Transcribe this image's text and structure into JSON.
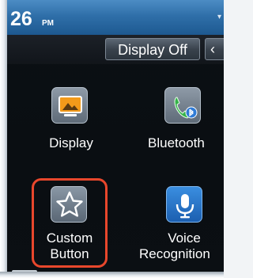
{
  "status_bar": {
    "time": "26",
    "ampm": "PM",
    "signal_icon": "signal-icon"
  },
  "toolbar": {
    "display_off_label": "Display Off",
    "next_icon": "arrow-icon"
  },
  "tiles": {
    "display": {
      "label": "Display",
      "icon": "display-icon"
    },
    "bluetooth": {
      "label": "Bluetooth",
      "icon": "bluetooth-phone-icon"
    },
    "custom": {
      "label_line1": "Custom",
      "label_line2": "Button",
      "icon": "star-icon"
    },
    "voice": {
      "label_line1": "Voice",
      "label_line2": "Recognition",
      "icon": "microphone-icon"
    }
  },
  "colors": {
    "accent_blue": "#2f6fa9",
    "highlight": "#e8472c"
  }
}
